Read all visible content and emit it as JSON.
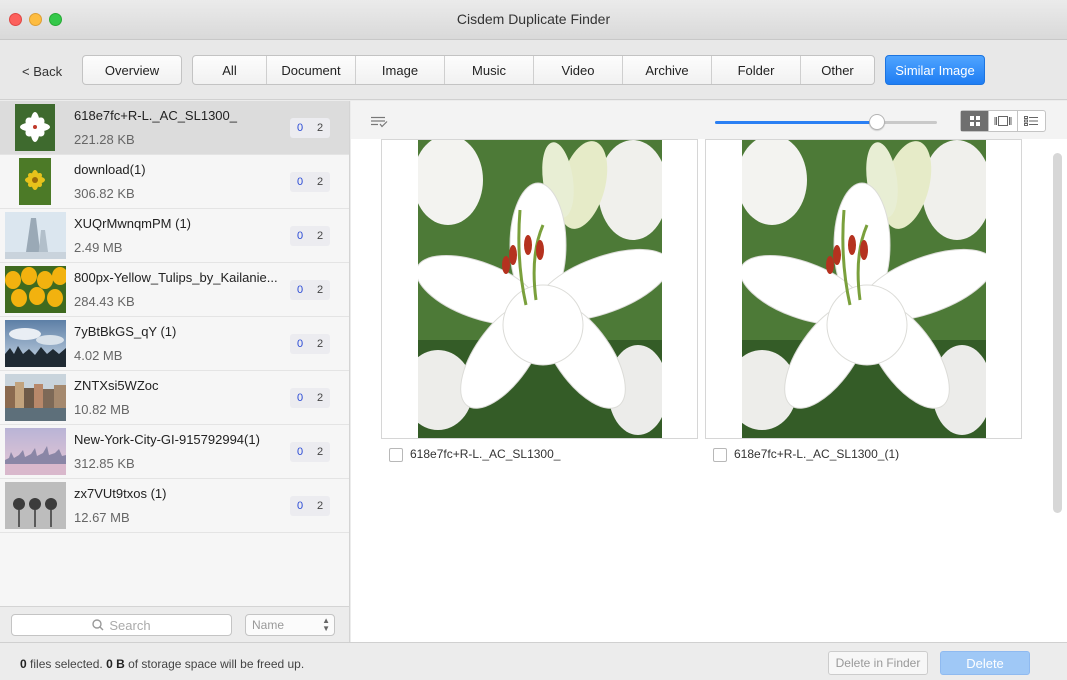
{
  "window": {
    "title": "Cisdem Duplicate Finder"
  },
  "toolbar": {
    "back": "< Back",
    "overview": "Overview",
    "tabs": [
      "All",
      "Document",
      "Image",
      "Music",
      "Video",
      "Archive",
      "Folder",
      "Other"
    ],
    "similar_image": "Similar Image"
  },
  "file_list": [
    {
      "name": "618e7fc+R-L._AC_SL1300_",
      "size": "221.28 KB",
      "selected_count": "0",
      "total_count": "2",
      "thumb": "white-lily"
    },
    {
      "name": "download(1)",
      "size": "306.82 KB",
      "selected_count": "0",
      "total_count": "2",
      "thumb": "yellow-flower"
    },
    {
      "name": "XUQrMwnqmPM (1)",
      "size": "2.49 MB",
      "selected_count": "0",
      "total_count": "2",
      "thumb": "church-spire"
    },
    {
      "name": "800px-Yellow_Tulips_by_Kailanie...",
      "size": "284.43 KB",
      "selected_count": "0",
      "total_count": "2",
      "thumb": "yellow-tulips"
    },
    {
      "name": "7yBtBkGS_qY (1)",
      "size": "4.02 MB",
      "selected_count": "0",
      "total_count": "2",
      "thumb": "cloudy-forest"
    },
    {
      "name": "ZNTXsi5WZoc",
      "size": "10.82 MB",
      "selected_count": "0",
      "total_count": "2",
      "thumb": "canal-city"
    },
    {
      "name": "New-York-City-GI-915792994(1)",
      "size": "312.85 KB",
      "selected_count": "0",
      "total_count": "2",
      "thumb": "city-skyline"
    },
    {
      "name": "zx7VUt9txos (1)",
      "size": "12.67 MB",
      "selected_count": "0",
      "total_count": "2",
      "thumb": "grey-bulbs"
    }
  ],
  "left_footer": {
    "search_placeholder": "Search",
    "sort_value": "Name"
  },
  "preview": {
    "zoom_level": 0.73,
    "items": [
      {
        "filename": "618e7fc+R-L._AC_SL1300_",
        "checked": false
      },
      {
        "filename": "618e7fc+R-L._AC_SL1300_(1)",
        "checked": false
      }
    ]
  },
  "status": {
    "files": "0",
    "files_text": " files selected. ",
    "size": "0 B",
    "size_text": " of storage space will be freed up."
  },
  "actions": {
    "delete_in_finder": "Delete in Finder",
    "delete": "Delete"
  },
  "colors": {
    "accent": "#1e7df3",
    "count_blue": "#2b4bd6"
  }
}
